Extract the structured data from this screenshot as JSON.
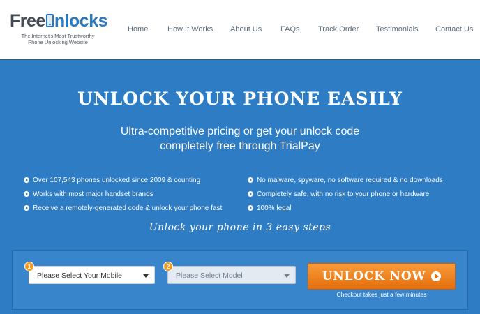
{
  "header": {
    "logo": {
      "free": "Free",
      "unlocks": "nlocks",
      "tagline_line1": "The Internet's Most Trustworthy",
      "tagline_line2": "Phone Unlocking Website"
    },
    "nav": [
      "Home",
      "How It Works",
      "About Us",
      "FAQs",
      "Track Order",
      "Testimonials",
      "Contact Us"
    ]
  },
  "hero": {
    "title": "UNLOCK YOUR PHONE EASILY",
    "subtitle_line1": "Ultra-competitive pricing or get your unlock code",
    "subtitle_line2": "completely free through TrialPay",
    "features_left": [
      "Over 107,543 phones unlocked since 2009 & counting",
      "Works with most major handset brands",
      "Receive a remotely-generated code & unlock your phone fast"
    ],
    "features_right": [
      "No malware, spyware, no software required & no downloads",
      "Completely safe, with no risk to your phone or hardware",
      "100% legal"
    ],
    "steps_text": "Unlock your phone in 3 easy steps"
  },
  "form": {
    "step1_number": "1",
    "step2_number": "2",
    "mobile_select": "Please Select Your Mobile",
    "model_select": "Please Select Model",
    "unlock_button": "UNLOCK NOW",
    "checkout_note": "Checkout takes just a few minutes"
  },
  "colors": {
    "hero_bg": "#2e7cc4",
    "logo_blue": "#2a78c0",
    "button_orange": "#f08a24",
    "nav_text": "#5d6d7c"
  }
}
